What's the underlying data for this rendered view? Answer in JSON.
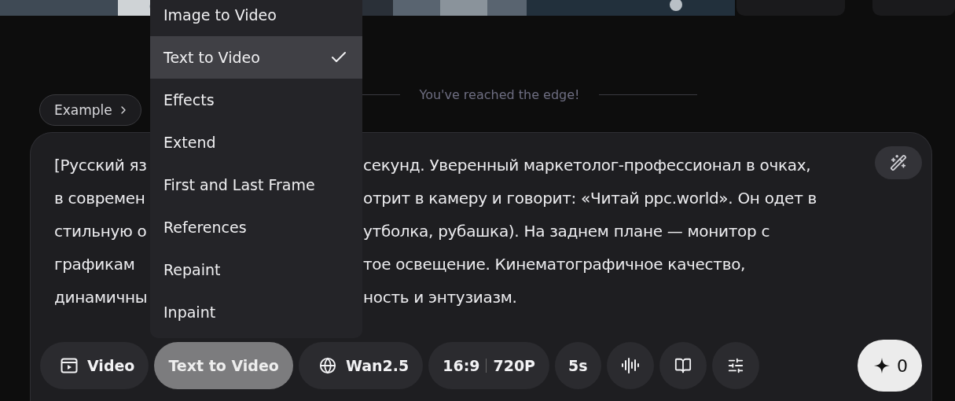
{
  "notice": "You've reached the edge!",
  "example_button": "Example",
  "prompt_lines": [
    {
      "left": "[Русский яз",
      "right": "секунд. Уверенный маркетолог-профессионал в очках,"
    },
    {
      "left": "в современ",
      "right": "отрит в камеру и говорит: «Читай ppc.world». Он одет в"
    },
    {
      "left": "стильную о",
      "right": "утболка, рубашка). На заднем плане — монитор с"
    },
    {
      "left": "графикам",
      "right": "тое освещение. Кинематографичное качество,"
    },
    {
      "left": "динамичны",
      "right": "ность и энтузиазм."
    }
  ],
  "mode_menu": [
    {
      "label": "Image to Video",
      "selected": false
    },
    {
      "label": "Text to Video",
      "selected": true
    },
    {
      "label": "Effects",
      "selected": false
    },
    {
      "label": "Extend",
      "selected": false
    },
    {
      "label": "First and Last Frame",
      "selected": false
    },
    {
      "label": "References",
      "selected": false
    },
    {
      "label": "Repaint",
      "selected": false
    },
    {
      "label": "Inpaint",
      "selected": false
    }
  ],
  "toolbar": [
    {
      "kind": "video",
      "label": "Video"
    },
    {
      "kind": "mode",
      "label": "Text to Video",
      "expanded": true
    },
    {
      "kind": "model",
      "label": "Wan2.5"
    },
    {
      "kind": "ratio",
      "labels": [
        "16:9",
        "720P"
      ]
    },
    {
      "kind": "plain",
      "label": "5s"
    },
    {
      "kind": "audio"
    },
    {
      "kind": "guide"
    },
    {
      "kind": "settings"
    }
  ],
  "credits": "0"
}
